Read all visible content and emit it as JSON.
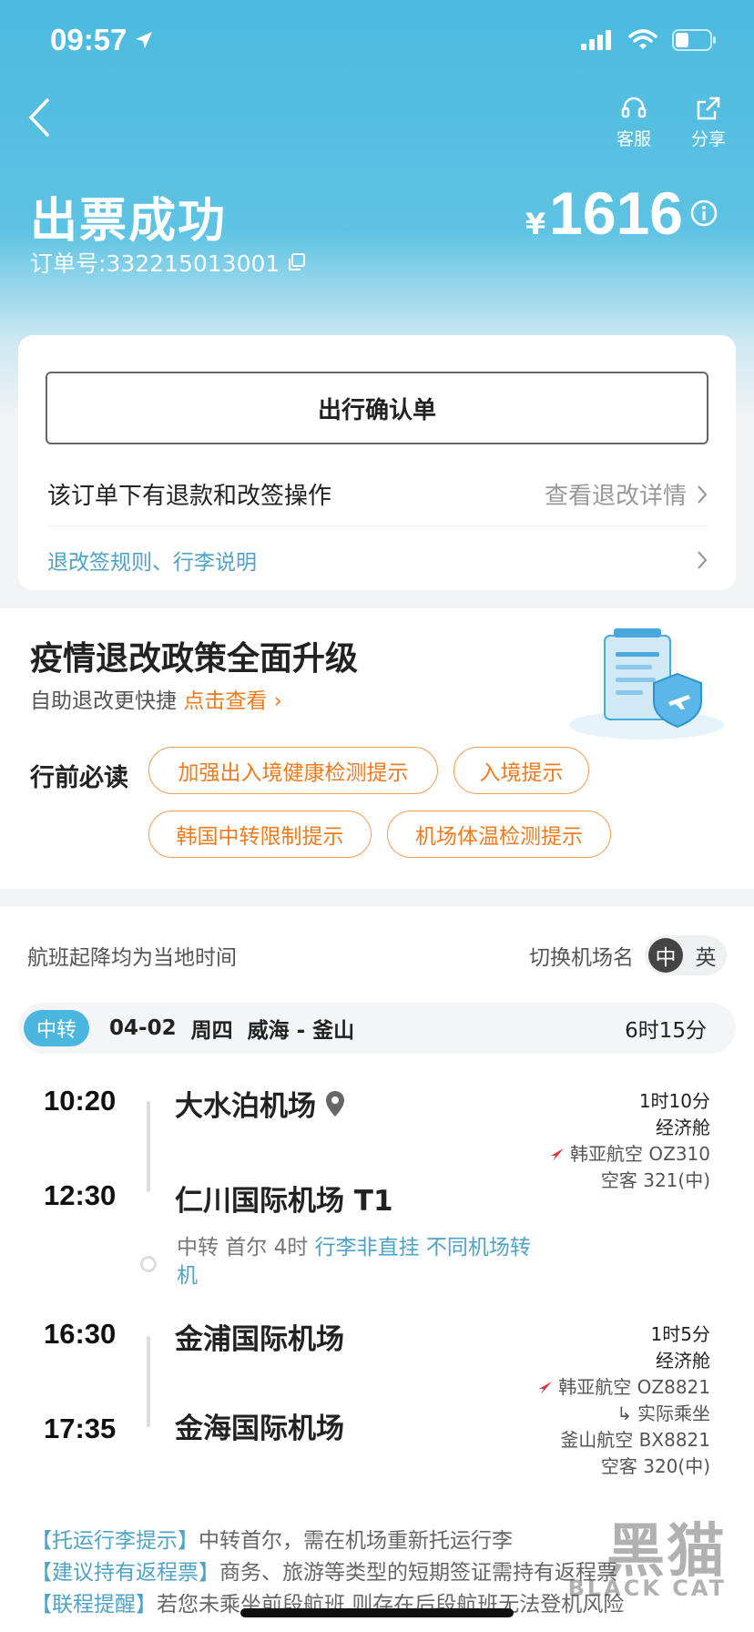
{
  "status_bar": {
    "time": "09:57"
  },
  "nav": {
    "service_label": "客服",
    "share_label": "分享"
  },
  "header": {
    "title": "出票成功",
    "order_label": "订单号:332215013001",
    "currency": "¥",
    "price": "1616"
  },
  "booking_card": {
    "confirm_button": "出行确认单",
    "refund_text": "该订单下有退款和改签操作",
    "refund_link": "查看退改详情",
    "rules_link": "退改签规则、行李说明"
  },
  "policy": {
    "title": "疫情退改政策全面升级",
    "subtitle": "自助退改更快捷",
    "link": "点击查看",
    "must_read_label": "行前必读",
    "pills": [
      "加强出入境健康检测提示",
      "入境提示",
      "韩国中转限制提示",
      "机场体温检测提示"
    ]
  },
  "itinerary": {
    "timezone_note": "航班起降均为当地时间",
    "switch_label": "切换机场名",
    "switch_on": "中",
    "switch_off": "英",
    "segment": {
      "tag": "中转",
      "date": "04-02",
      "weekday": "周四",
      "route": "威海 - 釜山",
      "duration": "6时15分"
    },
    "leg1": {
      "dep_time": "10:20",
      "dep_airport": "大水泊机场",
      "arr_time": "12:30",
      "arr_airport": "仁川国际机场 T1",
      "duration": "1时10分",
      "cabin": "经济舱",
      "airline": "韩亚航空 OZ310",
      "aircraft": "空客 321(中)"
    },
    "transfer": {
      "prefix": "中转 首尔 4时",
      "highlight": "行李非直挂 不同机场转机"
    },
    "leg2": {
      "dep_time": "16:30",
      "dep_airport": "金浦国际机场",
      "arr_time": "17:35",
      "arr_airport": "金海国际机场",
      "duration": "1时5分",
      "cabin": "经济舱",
      "airline": "韩亚航空 OZ8821",
      "actual_label": "实际乘坐",
      "actual_airline": "釜山航空 BX8821",
      "aircraft": "空客 320(中)"
    },
    "notes": [
      {
        "bracket": "【托运行李提示】",
        "text": "中转首尔，需在机场重新托运行李"
      },
      {
        "bracket": "【建议持有返程票】",
        "text": "商务、旅游等类型的短期签证需持有返程票"
      },
      {
        "bracket": "【联程提醒】",
        "text": "若您未乘坐前段航班,则存在后段航班无法登机风险"
      }
    ]
  },
  "watermark": {
    "big": "黑猫",
    "small": "BLACK CAT"
  },
  "colors": {
    "header_blue": "#4bbadf",
    "accent_orange": "#f07a1d",
    "link_blue": "#4fa3c6",
    "airline_red": "#e0323a"
  }
}
